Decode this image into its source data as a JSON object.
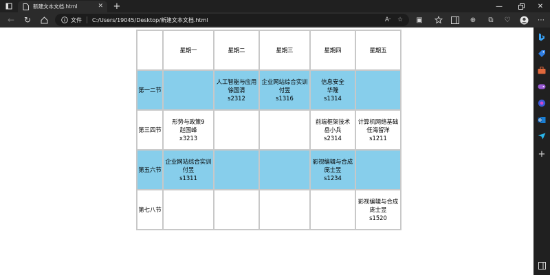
{
  "browser": {
    "tab": {
      "title": "新建文本文档.html"
    },
    "address": {
      "label": "文件",
      "url": "C:/Users/19045/Desktop/新建文本文档.html"
    }
  },
  "timetable": {
    "headers": [
      "",
      "星期一",
      "星期二",
      "星期三",
      "星期四",
      "星期五"
    ],
    "rows": [
      {
        "label": "第一二节",
        "highlight": true,
        "cells": [
          [],
          [
            "人工智能与应用",
            "徐国清",
            "s2312"
          ],
          [
            "企业网站综合实训",
            "付昱",
            "s1316"
          ],
          [
            "信息安全",
            "华隆",
            "s1314"
          ],
          []
        ]
      },
      {
        "label": "第三四节",
        "highlight": false,
        "cells": [
          [
            "形势与政策9",
            "赵国峰",
            "x3213"
          ],
          [],
          [],
          [
            "前端框架技术",
            "岳小兵",
            "s2314"
          ],
          [
            "计算机网络基础",
            "任海留洋",
            "s1211"
          ]
        ]
      },
      {
        "label": "第五六节",
        "highlight": true,
        "cells": [
          [
            "企业网站综合实训",
            "付昱",
            "s1311"
          ],
          [],
          [],
          [
            "影视编辑与合成",
            "庞士昱",
            "s1234"
          ],
          []
        ]
      },
      {
        "label": "第七八节",
        "highlight": false,
        "cells": [
          [],
          [],
          [],
          [],
          [
            "影视编辑与合成",
            "庞士昱",
            "s1520"
          ]
        ]
      }
    ],
    "colors": {
      "highlight": "#87ceeb",
      "border": "#c8c8c8"
    }
  }
}
